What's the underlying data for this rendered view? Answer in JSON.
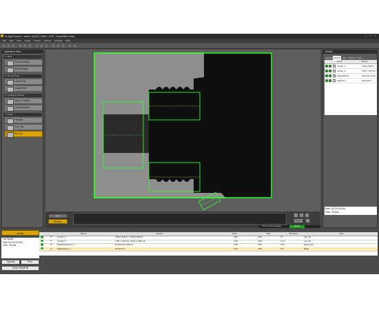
{
  "window": {
    "title": "In-Sight Explorer - admin - [is5705_Fisher - 5750 - EasyBuilder View]"
  },
  "menu": [
    "File",
    "Edit",
    "View",
    "Image",
    "Sensor",
    "System",
    "Window",
    "Help"
  ],
  "application_steps": {
    "header": "Application Steps",
    "groups": [
      {
        "label": "1. Start",
        "items": [
          {
            "label": "Get Connected"
          },
          {
            "label": "Set Up Image"
          }
        ]
      },
      {
        "label": "2. Set Up Tools",
        "items": [
          {
            "label": "Locate Part"
          },
          {
            "label": "Inspect Part"
          }
        ]
      },
      {
        "label": "3. Configure Results",
        "items": [
          {
            "label": "Inputs / Outputs"
          },
          {
            "label": "Communication"
          }
        ]
      },
      {
        "label": "4. Finish",
        "items": [
          {
            "label": "Filmstrip"
          },
          {
            "label": "Save Job"
          },
          {
            "label": "Run Job"
          }
        ]
      }
    ]
  },
  "viewer": {
    "pc_label": "PC",
    "sensor_label": "Sensor",
    "freeze_label": "Freeze",
    "status_text": "79% size Size Available",
    "online_chip": "Online"
  },
  "results_panel": {
    "header": "Results",
    "tabs": [
      "Filmstrip",
      "Results",
      "Job",
      "TestRun™",
      "Info"
    ],
    "columns": [
      "Name",
      "Result"
    ],
    "rows": [
      {
        "name": "LineFit_1",
        "result": "(789.2,508.7)"
      },
      {
        "name": "LineFit_2",
        "result": "(765.7,1447.6)"
      },
      {
        "name": "EdgePairDef...",
        "result": "Defects=0 Gap"
      },
      {
        "name": "EdgeDef...",
        "result": "Defects=0"
      }
    ],
    "rate": "Rate: 94.1% (32/34)",
    "time": "Time: 78.0ms"
  },
  "bottom_left": {
    "online_label": "Online",
    "job_status_lines": [
      "Job Status",
      "Rate: 94.1% (32/34)",
      "Time: 78.0ms"
    ],
    "options_label": "Options",
    "print_label": "Print",
    "clear_label": "Clear Pass/Fail"
  },
  "palette_table": {
    "columns": [
      "Name",
      "Result",
      "Pass",
      "Fail",
      "Time(ms)",
      "Type"
    ],
    "rows": [
      {
        "name": "LineFit_1",
        "result": "(789.2,508.7), (1491.0,395.2)",
        "pass": "0/10",
        "fail": "2/10",
        "time": "73",
        "type": "Line Fit"
      },
      {
        "name": "LineFit_2",
        "result": "(765.7,1447.6), (1471.0,1561.8)",
        "pass": "0/10",
        "fail": "2/10",
        "time": "13.3",
        "type": "Line Fit"
      },
      {
        "name": "EdgePairDefect_1",
        "result": "Defects=0 Gaps=0",
        "pass": "0/10",
        "fail": "2/10",
        "time": "42.6",
        "type": "Edge Pair"
      },
      {
        "name": "EdgeDefect_1",
        "result": "Defects=0",
        "pass": "0/10",
        "fail": "2/10",
        "time": "5.0",
        "type": "Edge"
      }
    ]
  },
  "colors": {
    "accent": "#d9a400",
    "pass_green": "#2aa52a",
    "overlay_green": "#2cff2c"
  }
}
